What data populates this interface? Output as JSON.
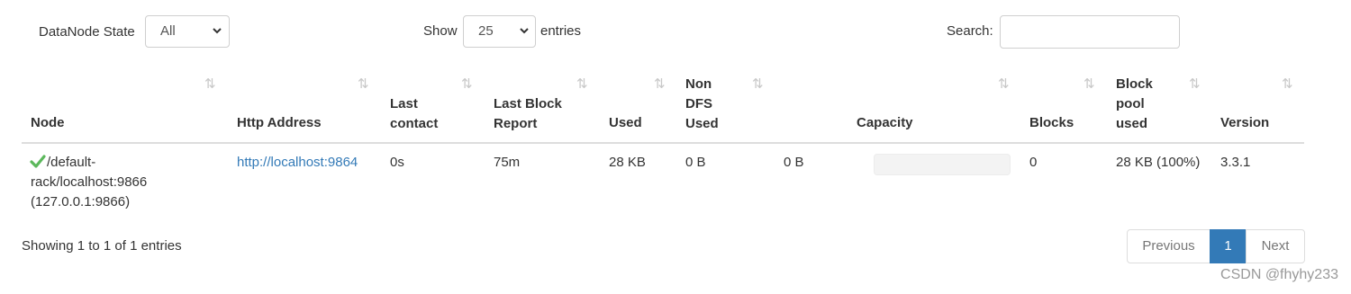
{
  "filters": {
    "state_label": "DataNode State",
    "state_value": "All",
    "show_label": "Show",
    "show_value": "25",
    "entries_label": "entries",
    "search_label": "Search:",
    "search_value": ""
  },
  "table": {
    "headers": {
      "node": "Node",
      "http_line1": "Http Address",
      "last_contact_1": "Last",
      "last_contact_2": "contact",
      "last_block_1": "Last Block",
      "last_block_2": "Report",
      "used": "Used",
      "non_dfs_1": "Non",
      "non_dfs_2": "DFS",
      "non_dfs_3": "Used",
      "capacity": "Capacity",
      "blocks": "Blocks",
      "pool_1": "Block",
      "pool_2": "pool",
      "pool_3": "used",
      "version": "Version"
    },
    "sort_icon": "⇅",
    "row": {
      "status_icon": "check-icon",
      "node_line1": "/default-",
      "node_line2": "rack/localhost:9866",
      "node_line3": "(127.0.0.1:9866)",
      "http_address": "http://localhost:9864",
      "last_contact": "0s",
      "last_block_report": "75m",
      "used": "28 KB",
      "non_dfs_used": "0 B",
      "capacity_value": "0 B",
      "capacity_used_fraction": 0,
      "blocks": "0",
      "block_pool_used": "28 KB (100%)",
      "version": "3.3.1"
    }
  },
  "footer": {
    "info": "Showing 1 to 1 of 1 entries",
    "previous": "Previous",
    "current_page": "1",
    "next": "Next"
  },
  "watermark": "CSDN @fhyhy233",
  "colors": {
    "accent": "#337ab7",
    "check": "#5cb85c"
  }
}
